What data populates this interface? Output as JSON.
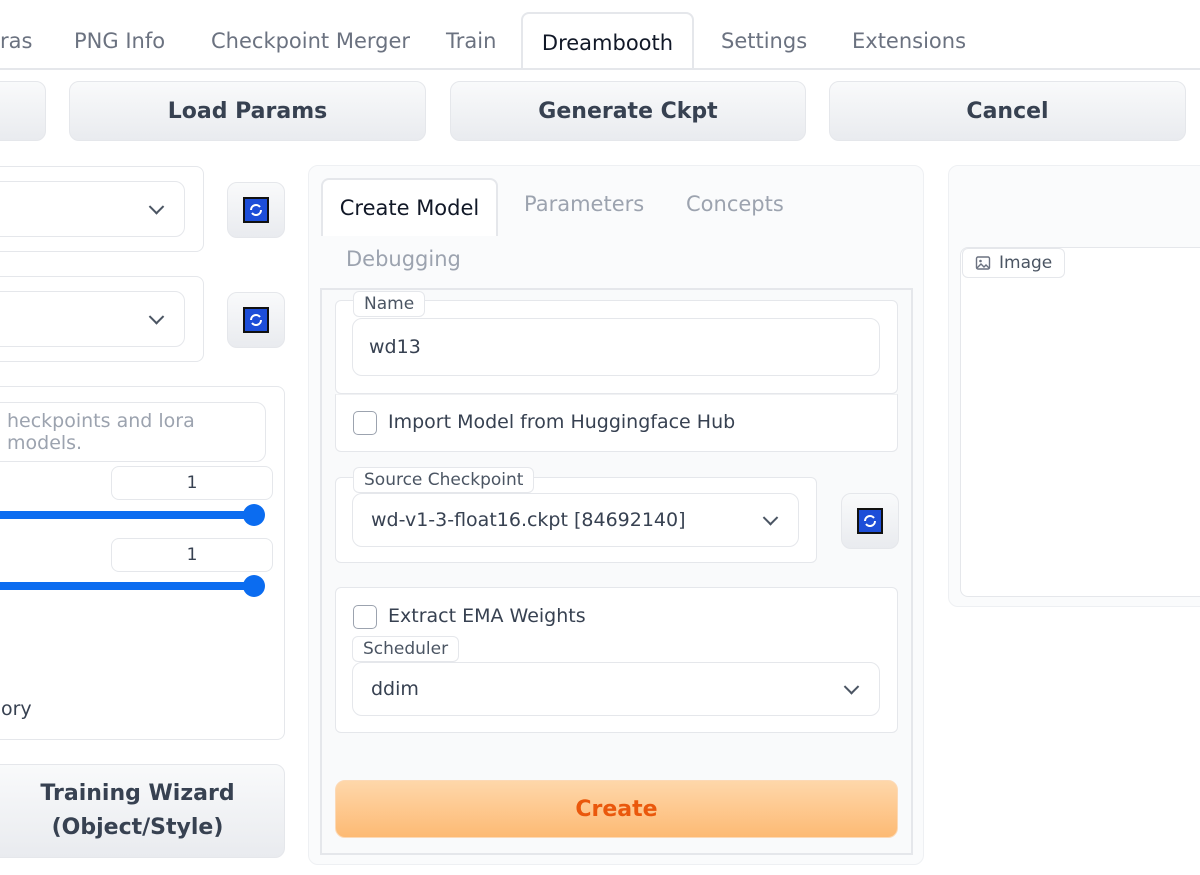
{
  "top_tabs": [
    {
      "label": "ras"
    },
    {
      "label": "PNG Info"
    },
    {
      "label": "Checkpoint Merger"
    },
    {
      "label": "Train"
    },
    {
      "label": "Dreambooth",
      "active": true
    },
    {
      "label": "Settings"
    },
    {
      "label": "Extensions"
    }
  ],
  "toolbar": {
    "load_params": "Load Params",
    "generate_ckpt": "Generate Ckpt",
    "cancel": "Cancel"
  },
  "left": {
    "textbox_placeholder": "heckpoints and lora models.",
    "slider1_value": "1",
    "slider2_value": "1",
    "partial_label": "ory",
    "wizard_line1": "Training Wizard",
    "wizard_line2": "(Object/Style)"
  },
  "center": {
    "tabs": [
      {
        "label": "Create Model",
        "active": true
      },
      {
        "label": "Parameters"
      },
      {
        "label": "Concepts"
      },
      {
        "label": "Debugging"
      }
    ],
    "name_label": "Name",
    "name_value": "wd13",
    "import_hub_label": "Import Model from Huggingface Hub",
    "source_checkpoint_label": "Source Checkpoint",
    "source_checkpoint_value": "wd-v1-3-float16.ckpt [84692140]",
    "extract_ema_label": "Extract EMA Weights",
    "scheduler_label": "Scheduler",
    "scheduler_value": "ddim",
    "create_button": "Create"
  },
  "right": {
    "image_label": "Image"
  },
  "colors": {
    "accent": "#0b6cf0",
    "create_button_text": "#ea580c",
    "create_button_bg_from": "#fed7aa",
    "create_button_bg_to": "#fdba74"
  }
}
